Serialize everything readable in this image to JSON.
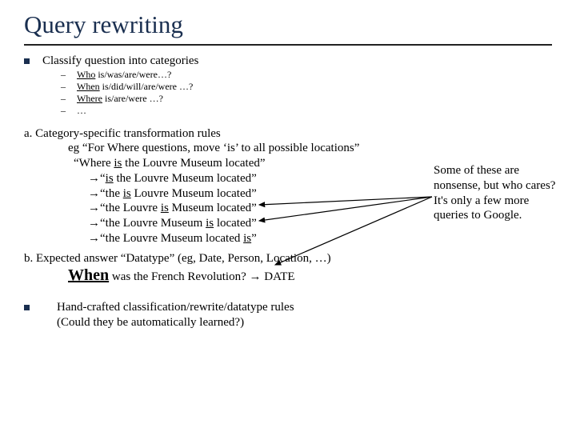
{
  "title": "Query rewriting",
  "classify": "Classify question into categories",
  "categories": [
    {
      "word": "Who",
      "rest": " is/was/are/were…?"
    },
    {
      "word": "When",
      "rest": " is/did/will/are/were …?"
    },
    {
      "word": "Where",
      "rest": " is/are/were …?"
    },
    {
      "word": "",
      "rest": "…"
    }
  ],
  "a_heading": "a. Category-specific transformation rules",
  "a_eg": "eg “For Where questions, move ‘is’ to all possible locations”",
  "a_quote_pre": "“Where ",
  "a_quote_is": "is",
  "a_quote_post": " the Louvre Museum located”",
  "arrows": [
    {
      "pre": "→“",
      "u": "is",
      "post": " the Louvre Museum located”"
    },
    {
      "pre": "→“the ",
      "u": "is",
      "post": " Louvre Museum located”"
    },
    {
      "pre": "→“the Louvre ",
      "u": "is",
      "post": " Museum located”"
    },
    {
      "pre": "→“the Louvre Museum ",
      "u": "is",
      "post": " located”"
    },
    {
      "pre": "→“the Louvre Museum located ",
      "u": "is",
      "post": "”"
    }
  ],
  "b_heading": "b. Expected answer “Datatype” (eg, Date, Person, Location, …)",
  "b_when": "When",
  "b_rest": " was the French Revolution?  → DATE",
  "hand_l1": "Hand-crafted classification/rewrite/datatype rules",
  "hand_l2": "(Could they be automatically learned?)",
  "side": "Some of these are nonsense,\nbut who cares?  It's only a few more queries to Google."
}
